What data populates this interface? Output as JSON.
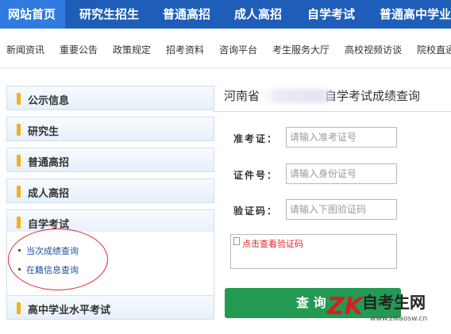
{
  "topnav": {
    "items": [
      "网站首页",
      "研究生招生",
      "普通高招",
      "成人高招",
      "自学考试",
      "普通高中学业水"
    ]
  },
  "subnav": {
    "items": [
      "新闻资讯",
      "重要公告",
      "政策规定",
      "招考资料",
      "咨询平台",
      "考生服务大厅",
      "高校视频访谈",
      "院校直通"
    ]
  },
  "sidebar": {
    "categories": [
      "公示信息",
      "研究生",
      "普通高招",
      "成人高招",
      "自学考试",
      "高中学业水平考试"
    ],
    "sublinks": [
      "当次成绩查询",
      "在籍信息查询"
    ]
  },
  "form": {
    "title_prefix": "河南省",
    "title_suffix": "自学考试成绩查询",
    "fields": [
      {
        "label": "准考证：",
        "placeholder": "请输入准考证号"
      },
      {
        "label": "证件号：",
        "placeholder": "请输入身份证号"
      },
      {
        "label": "验证码：",
        "placeholder": "请输入下图验证码"
      }
    ],
    "captcha_text": "点击查看验证码",
    "submit_label": "查 询"
  },
  "watermark": {
    "logo": "ZK",
    "name": "自考生网",
    "url": "www.zikaosw.cn"
  },
  "colors": {
    "nav_bg": "#1e5eb8",
    "nav_active": "#2f7be0",
    "accent_bar": "#f1b31c",
    "submit_bg": "#239a52",
    "highlight_ring": "#e02a2a"
  }
}
